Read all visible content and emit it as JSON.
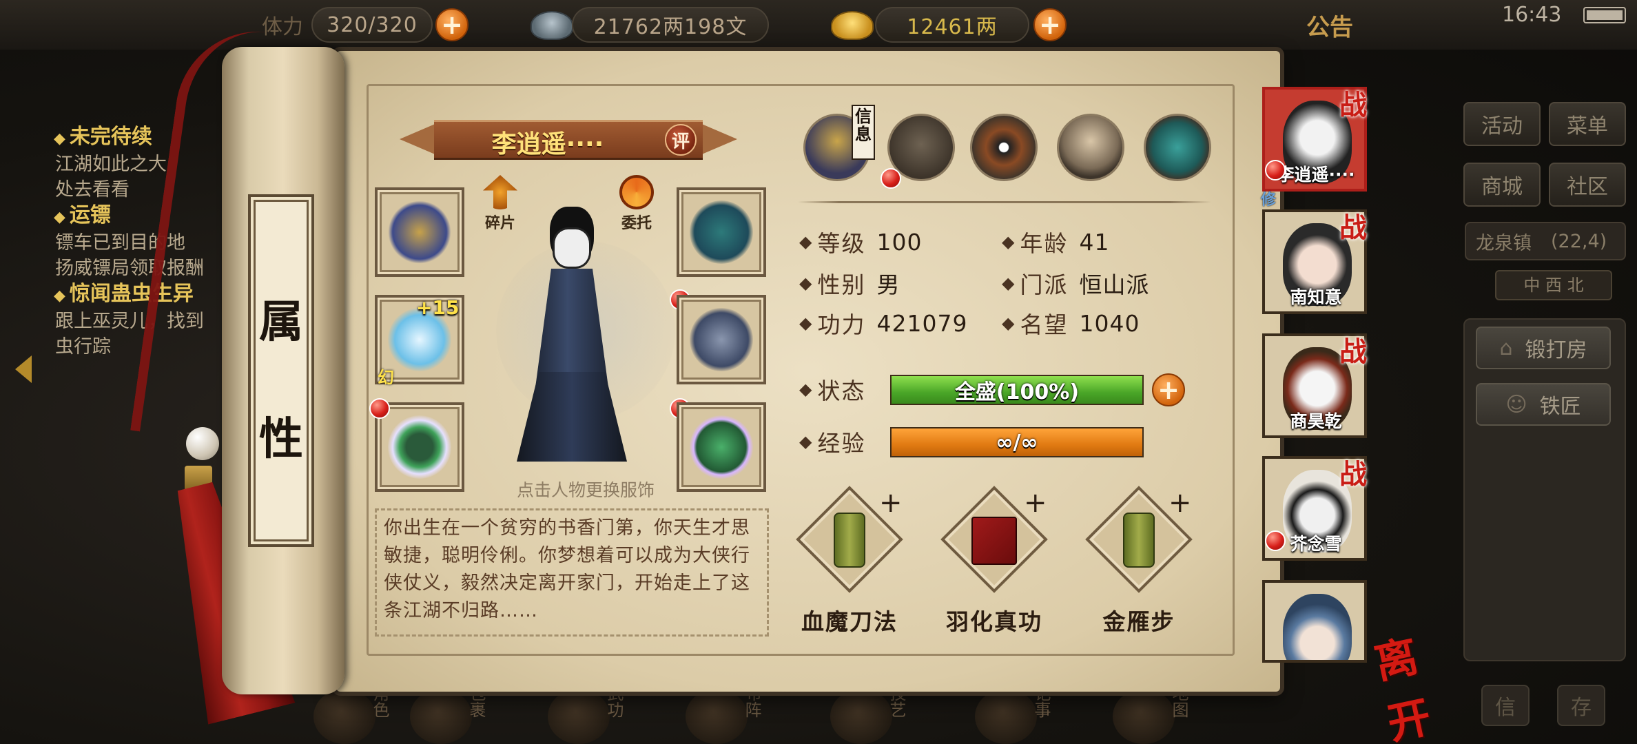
{
  "topbar": {
    "stamina": "320/320",
    "stamina_label_partial": "体力",
    "silver": "21762两198文",
    "gold": "12461两",
    "notice": "公告",
    "clock": "16:43"
  },
  "quests": [
    {
      "title": "未完待续",
      "lines": [
        "江湖如此之大",
        "处去看看"
      ]
    },
    {
      "title": "运镖",
      "lines": [
        "镖车已到目的地",
        "扬威镖局领取报酬"
      ]
    },
    {
      "title": "惊闻蛊虫生异",
      "lines": [
        "跟上巫灵儿，找到",
        "虫行踪"
      ]
    }
  ],
  "side_menu": {
    "activity": "活动",
    "menu": "菜单",
    "shop": "商城",
    "community": "社区",
    "location": "龙泉镇",
    "coords": "(22,4)",
    "compass": "中  西  北",
    "forge": "锻打房",
    "smith": "铁匠",
    "letter": "信",
    "save": "存"
  },
  "dock": [
    "角色",
    "包裹",
    "武功",
    "布阵",
    "技艺",
    "记事",
    "地图"
  ],
  "scroll_label": [
    "属",
    "性"
  ],
  "character": {
    "name": "李逍遥····",
    "rate_btn": "评",
    "fragment_btn": "碎片",
    "commission_btn": "委托",
    "weapon_enhance": "+15",
    "weapon_tag": "幻",
    "change_outfit_hint": "点击人物更换服饰",
    "bio": "你出生在一个贫穷的书香门第，你天生才思敏捷，聪明伶俐。你梦想着可以成为大侠行侠仗义，毅然决定离开家门，开始走上了这条江湖不归路……"
  },
  "info_tag": "信息",
  "stats": {
    "level_label": "等级",
    "level": "100",
    "age_label": "年龄",
    "age": "41",
    "gender_label": "性别",
    "gender": "男",
    "sect_label": "门派",
    "sect": "恒山派",
    "power_label": "功力",
    "power": "421079",
    "fame_label": "名望",
    "fame": "1040",
    "status_label": "状态",
    "status": "全盛(100%)",
    "status_fraction": 1.0,
    "exp_label": "经验",
    "exp": "∞/∞",
    "exp_fraction": 1.0
  },
  "skills": [
    {
      "name": "血魔刀法",
      "plus": "+"
    },
    {
      "name": "羽化真功",
      "plus": "+"
    },
    {
      "name": "金雁步",
      "plus": "+"
    }
  ],
  "party": [
    {
      "name": "李逍遥····",
      "battle": "战",
      "tag": "修"
    },
    {
      "name": "南知意",
      "battle": "战"
    },
    {
      "name": "商昊乾",
      "battle": "战"
    },
    {
      "name": "芥念雪",
      "battle": "战"
    },
    {
      "name": ""
    }
  ],
  "leave": "离开",
  "colors": {
    "hp_bar": "#6cc23a",
    "exp_bar": "#e67c10",
    "accent_red": "#c91d15",
    "gold_text": "#ffe27a"
  }
}
